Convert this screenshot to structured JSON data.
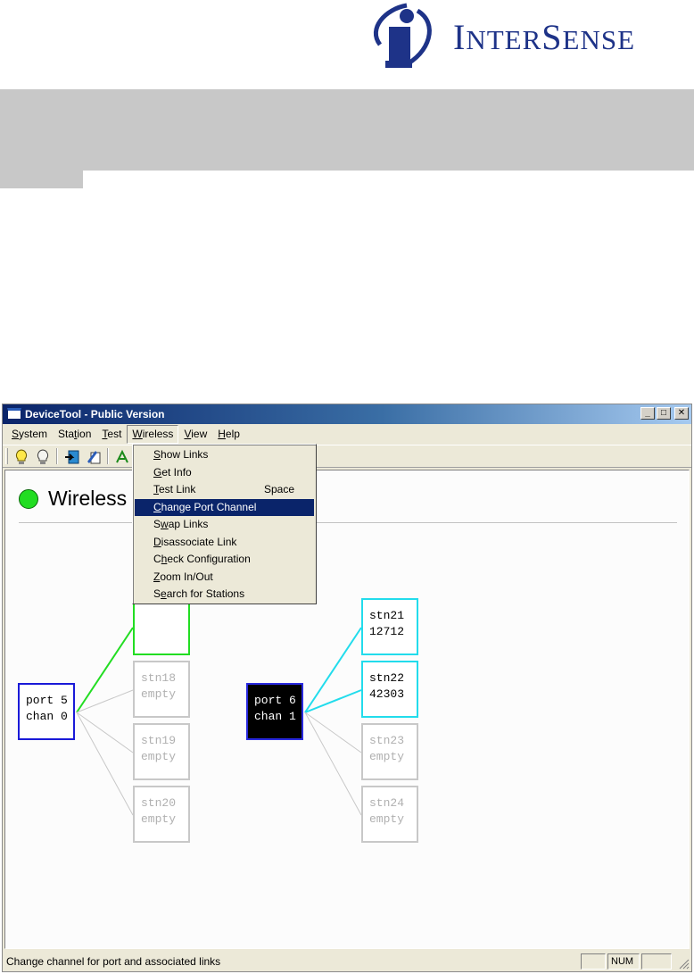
{
  "brand": {
    "name_cap_i": "I",
    "name_rest1": "NTER",
    "name_cap_s": "S",
    "name_rest2": "ENSE"
  },
  "window": {
    "title": "DeviceTool - Public Version",
    "controls": {
      "minimize": "_",
      "maximize": "□",
      "close": "✕"
    }
  },
  "menubar": [
    {
      "label": "System",
      "key": "S",
      "rest": "ystem"
    },
    {
      "label": "Station",
      "pre": "Sta",
      "key": "t",
      "rest": "ion"
    },
    {
      "label": "Test",
      "key": "T",
      "rest": "est"
    },
    {
      "label": "Wireless",
      "key": "W",
      "rest": "ireless"
    },
    {
      "label": "View",
      "key": "V",
      "rest": "iew"
    },
    {
      "label": "Help",
      "key": "H",
      "rest": "elp"
    }
  ],
  "toolbar": {
    "icons": [
      "bulb-on-icon",
      "bulb-off-icon",
      "link-in-icon",
      "link-edit-icon",
      "wireless-tool-icon"
    ]
  },
  "wireless_menu": {
    "items": [
      {
        "key": "S",
        "rest": "how Links",
        "accel": ""
      },
      {
        "key": "G",
        "rest": "et Info",
        "accel": ""
      },
      {
        "key": "T",
        "rest": "est Link",
        "accel": "Space"
      },
      {
        "key": "C",
        "rest": "hange Port Channel",
        "accel": "",
        "highlighted": true
      },
      {
        "pre": "S",
        "key": "w",
        "rest": "ap Links",
        "accel": ""
      },
      {
        "key": "D",
        "rest": "isassociate Link",
        "accel": ""
      },
      {
        "pre": "C",
        "key": "h",
        "rest": "eck Configuration",
        "accel": ""
      },
      {
        "key": "Z",
        "rest": "oom In/Out",
        "accel": ""
      },
      {
        "pre": "S",
        "key": "e",
        "rest": "arch for Stations",
        "accel": ""
      }
    ]
  },
  "canvas": {
    "title": "Wireless",
    "status_color": "#22dd22",
    "ports": [
      {
        "label": "port 5\nchan 0",
        "dark": false
      },
      {
        "label": "port 6\nchan 1",
        "dark": true
      }
    ],
    "stations": [
      {
        "label": "",
        "state": "hidden-green"
      },
      {
        "label": "stn18\nempty",
        "state": "empty"
      },
      {
        "label": "stn19\nempty",
        "state": "empty"
      },
      {
        "label": "stn20\nempty",
        "state": "empty"
      },
      {
        "label": "stn21\n12712",
        "state": "linked"
      },
      {
        "label": "stn22\n42303",
        "state": "linked"
      },
      {
        "label": "stn23\nempty",
        "state": "empty"
      },
      {
        "label": "stn24\nempty",
        "state": "empty"
      }
    ],
    "colors": {
      "port_border": "#1a1ad8",
      "link_green": "#22dd22",
      "link_cyan": "#22dcec",
      "link_gray": "#c8c8c8"
    }
  },
  "statusbar": {
    "message": "Change channel for port and associated links",
    "num": "NUM"
  }
}
